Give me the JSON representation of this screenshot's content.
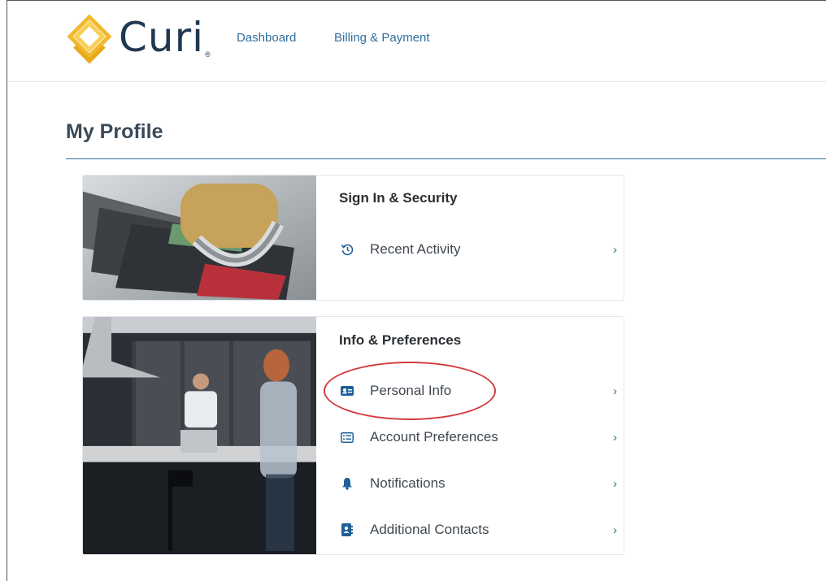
{
  "brand": {
    "name": "Curi",
    "trademark": "®",
    "colors": {
      "primary": "#21384f",
      "gold": "#f2b82e",
      "link": "#2f6f9f",
      "chevron": "#2f7d63",
      "annotation": "#d53b3b"
    }
  },
  "nav": {
    "items": [
      {
        "label": "Dashboard"
      },
      {
        "label": "Billing & Payment"
      }
    ]
  },
  "page": {
    "title": "My Profile"
  },
  "cards": [
    {
      "heading": "Sign In & Security",
      "image": "credit-cards-padlock-photo",
      "items": [
        {
          "label": "Recent Activity",
          "icon": "history-icon"
        }
      ]
    },
    {
      "heading": "Info & Preferences",
      "image": "kitchen-people-photo",
      "items": [
        {
          "label": "Personal Info",
          "icon": "id-card-icon"
        },
        {
          "label": "Account Preferences",
          "icon": "list-icon"
        },
        {
          "label": "Notifications",
          "icon": "bell-icon"
        },
        {
          "label": "Additional Contacts",
          "icon": "address-book-icon"
        }
      ]
    }
  ],
  "chevron": "›"
}
